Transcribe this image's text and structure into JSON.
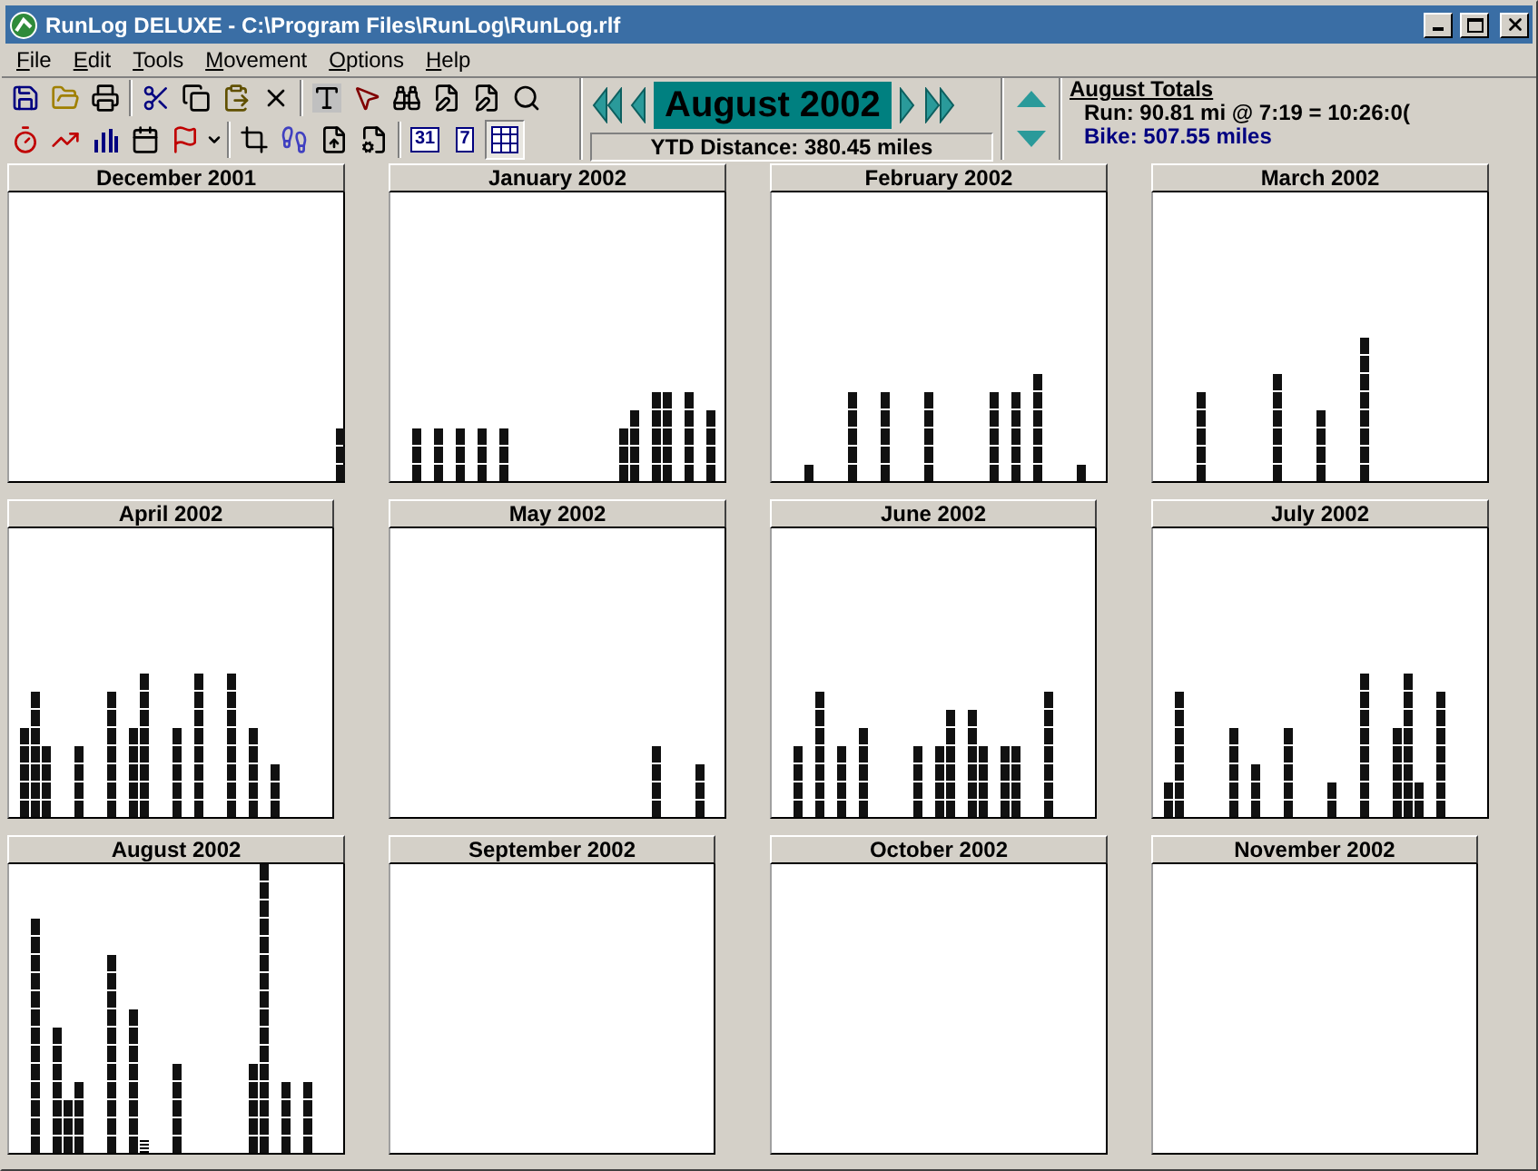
{
  "window": {
    "title": "RunLog DELUXE - C:\\Program Files\\RunLog\\RunLog.rlf"
  },
  "menu": [
    "File",
    "Edit",
    "Tools",
    "Movement",
    "Options",
    "Help"
  ],
  "view_buttons": [
    {
      "label": "31",
      "selected": false
    },
    {
      "label": "7",
      "selected": false
    },
    {
      "selected": true
    }
  ],
  "navigator": {
    "month": "August 2002",
    "ytd": "YTD Distance: 380.45 miles"
  },
  "totals": {
    "title": "August Totals",
    "lines": [
      {
        "text": "Run: 90.81 mi @ 7:19 = 10:26:0(",
        "color": "#000000"
      },
      {
        "text": "Bike: 507.55 miles",
        "color": "#000080"
      }
    ]
  },
  "months": [
    {
      "title": "December 2001"
    },
    {
      "title": "January 2002"
    },
    {
      "title": "February 2002"
    },
    {
      "title": "March 2002"
    },
    {
      "title": "April 2002"
    },
    {
      "title": "May 2002"
    },
    {
      "title": "June 2002"
    },
    {
      "title": "July 2002"
    },
    {
      "title": "August 2002"
    },
    {
      "title": "September 2002"
    },
    {
      "title": "October 2002"
    },
    {
      "title": "November 2002"
    }
  ]
}
